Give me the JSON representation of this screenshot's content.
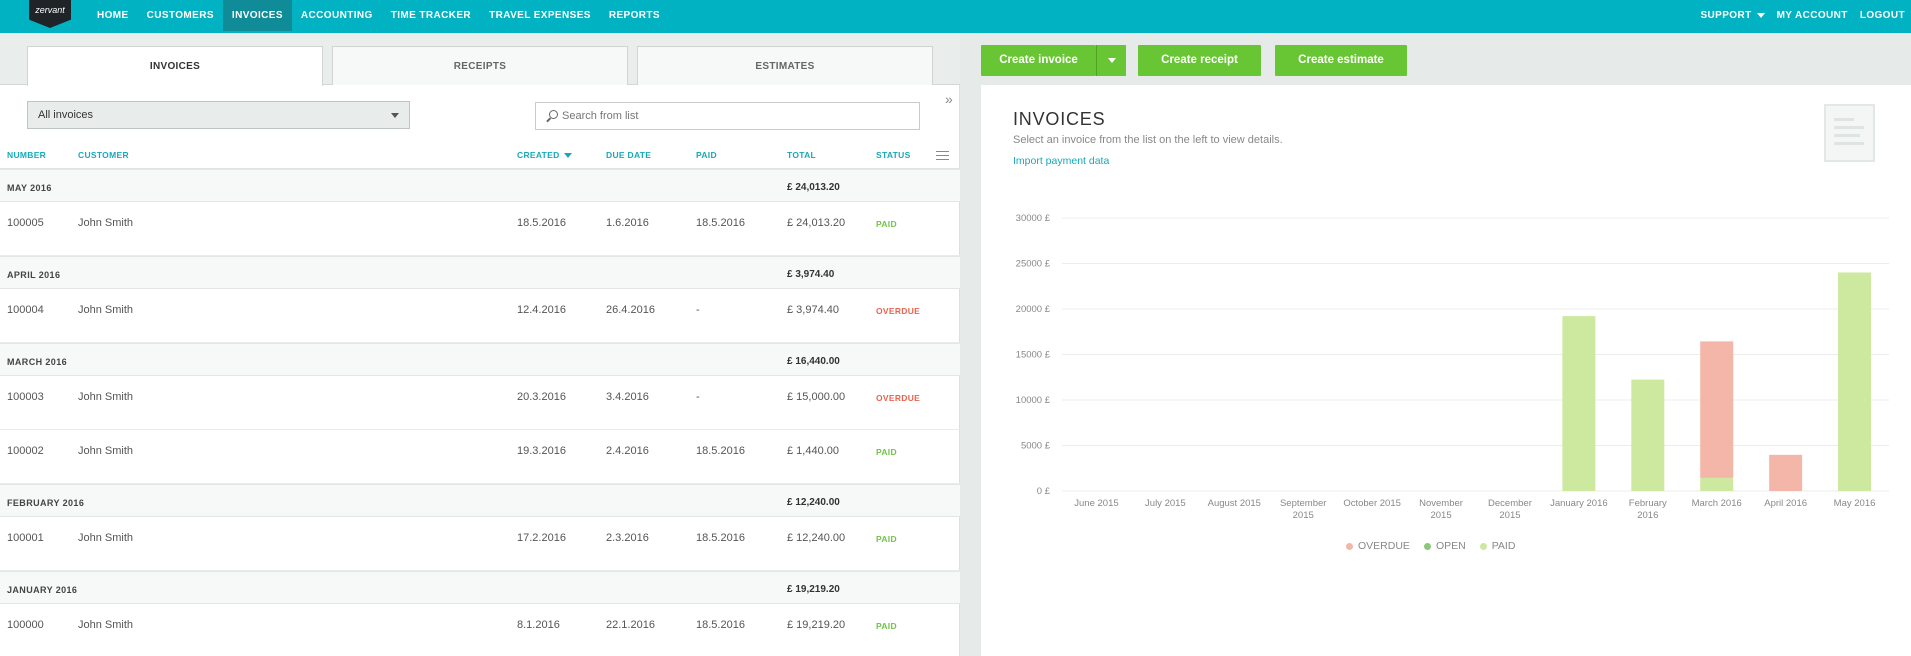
{
  "nav": {
    "logo": "zervant",
    "items": [
      "HOME",
      "CUSTOMERS",
      "INVOICES",
      "ACCOUNTING",
      "TIME TRACKER",
      "TRAVEL EXPENSES",
      "REPORTS"
    ],
    "active": "INVOICES",
    "support": "SUPPORT",
    "my_account": "MY ACCOUNT",
    "logout": "LOGOUT"
  },
  "tabs": [
    "INVOICES",
    "RECEIPTS",
    "ESTIMATES"
  ],
  "filter": {
    "selected": "All invoices"
  },
  "search": {
    "placeholder": "Search from list"
  },
  "columns": {
    "number": "NUMBER",
    "customer": "CUSTOMER",
    "created": "CREATED",
    "due": "DUE DATE",
    "paid": "PAID",
    "total": "TOTAL",
    "status": "STATUS"
  },
  "groups": [
    {
      "label": "MAY 2016",
      "total": "£ 24,013.20",
      "rows": [
        {
          "number": "100005",
          "customer": "John Smith",
          "created": "18.5.2016",
          "due": "1.6.2016",
          "paid": "18.5.2016",
          "total": "£ 24,013.20",
          "status": "PAID"
        }
      ]
    },
    {
      "label": "APRIL 2016",
      "total": "£ 3,974.40",
      "rows": [
        {
          "number": "100004",
          "customer": "John Smith",
          "created": "12.4.2016",
          "due": "26.4.2016",
          "paid": "-",
          "total": "£ 3,974.40",
          "status": "OVERDUE"
        }
      ]
    },
    {
      "label": "MARCH 2016",
      "total": "£ 16,440.00",
      "rows": [
        {
          "number": "100003",
          "customer": "John Smith",
          "created": "20.3.2016",
          "due": "3.4.2016",
          "paid": "-",
          "total": "£ 15,000.00",
          "status": "OVERDUE"
        },
        {
          "number": "100002",
          "customer": "John Smith",
          "created": "19.3.2016",
          "due": "2.4.2016",
          "paid": "18.5.2016",
          "total": "£ 1,440.00",
          "status": "PAID"
        }
      ]
    },
    {
      "label": "FEBRUARY 2016",
      "total": "£ 12,240.00",
      "rows": [
        {
          "number": "100001",
          "customer": "John Smith",
          "created": "17.2.2016",
          "due": "2.3.2016",
          "paid": "18.5.2016",
          "total": "£ 12,240.00",
          "status": "PAID"
        }
      ]
    },
    {
      "label": "JANUARY 2016",
      "total": "£ 19,219.20",
      "rows": [
        {
          "number": "100000",
          "customer": "John Smith",
          "created": "8.1.2016",
          "due": "22.1.2016",
          "paid": "18.5.2016",
          "total": "£ 19,219.20",
          "status": "PAID"
        }
      ]
    }
  ],
  "actions": {
    "create_invoice": "Create invoice",
    "create_receipt": "Create receipt",
    "create_estimate": "Create estimate"
  },
  "panel": {
    "title": "INVOICES",
    "subtitle": "Select an invoice from the list on the left to view details.",
    "link": "Import payment data"
  },
  "colors": {
    "overdue": "#f4b6a8",
    "open": "#8cc879",
    "paid": "#cde9a0",
    "brand": "#00b2c2",
    "green": "#68c634"
  },
  "chart_data": {
    "type": "bar",
    "stacked": true,
    "categories": [
      "June 2015",
      "July 2015",
      "August 2015",
      "September 2015",
      "October 2015",
      "November 2015",
      "December 2015",
      "January 2016",
      "February 2016",
      "March 2016",
      "April 2016",
      "May 2016"
    ],
    "series": [
      {
        "name": "PAID",
        "values": [
          0,
          0,
          0,
          0,
          0,
          0,
          0,
          19219.2,
          12240,
          1440,
          0,
          24013.2
        ]
      },
      {
        "name": "OPEN",
        "values": [
          0,
          0,
          0,
          0,
          0,
          0,
          0,
          0,
          0,
          0,
          0,
          0
        ]
      },
      {
        "name": "OVERDUE",
        "values": [
          0,
          0,
          0,
          0,
          0,
          0,
          0,
          0,
          0,
          15000,
          3974.4,
          0
        ]
      }
    ],
    "y_ticks": [
      "0 £",
      "5000 £",
      "10000 £",
      "15000 £",
      "20000 £",
      "25000 £",
      "30000 £"
    ],
    "ylim": [
      0,
      30000
    ],
    "legend": [
      "OVERDUE",
      "OPEN",
      "PAID"
    ],
    "legend_position": "bottom",
    "grid": true
  }
}
